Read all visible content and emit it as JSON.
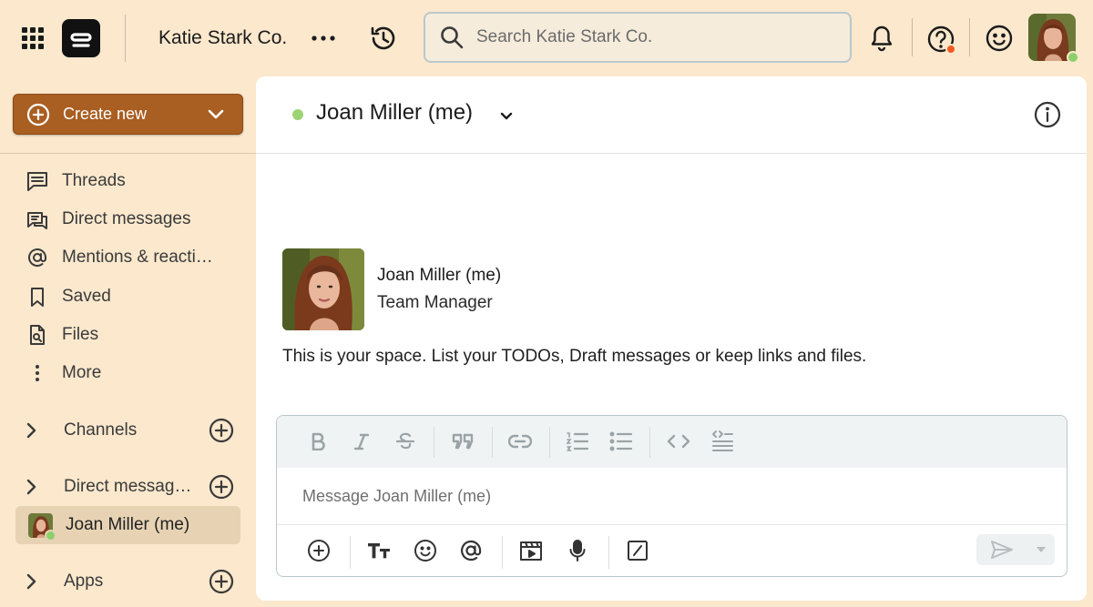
{
  "topbar": {
    "workspace_name": "Katie Stark Co.",
    "search_placeholder": "Search Katie Stark Co.",
    "help_badge_color": "#ef5a23",
    "status_color": "#8ccf6b"
  },
  "sidebar": {
    "create_new_label": "Create new",
    "create_new_color": "#a95e22",
    "nav_items": [
      {
        "label": "Threads",
        "icon": "threads-icon"
      },
      {
        "label": "Direct messages",
        "icon": "direct-messages-icon"
      },
      {
        "label": "Mentions & reacti…",
        "icon": "at-sign-icon"
      },
      {
        "label": "Saved",
        "icon": "bookmark-icon"
      },
      {
        "label": "Files",
        "icon": "file-search-icon"
      },
      {
        "label": "More",
        "icon": "more-vertical-icon"
      }
    ],
    "sections": {
      "channels": "Channels",
      "direct_messages": "Direct messag…",
      "apps": "Apps"
    },
    "dm_selected": "Joan Miller (me)"
  },
  "channel": {
    "title": "Joan Miller (me)",
    "presence_color": "#9ed374",
    "profile_name": "Joan Miller (me)",
    "profile_role": "Team Manager",
    "intro_text": "This is your space. List your TODOs, Draft messages or keep links and files."
  },
  "composer": {
    "placeholder": "Message Joan Miller (me)",
    "format_tools": [
      "bold",
      "italic",
      "strikethrough",
      "quote",
      "link",
      "numbered-list",
      "bulleted-list",
      "code",
      "code-block"
    ],
    "actions": [
      "attach",
      "formatting",
      "emoji",
      "mention",
      "gif",
      "voice",
      "slash-command"
    ]
  }
}
